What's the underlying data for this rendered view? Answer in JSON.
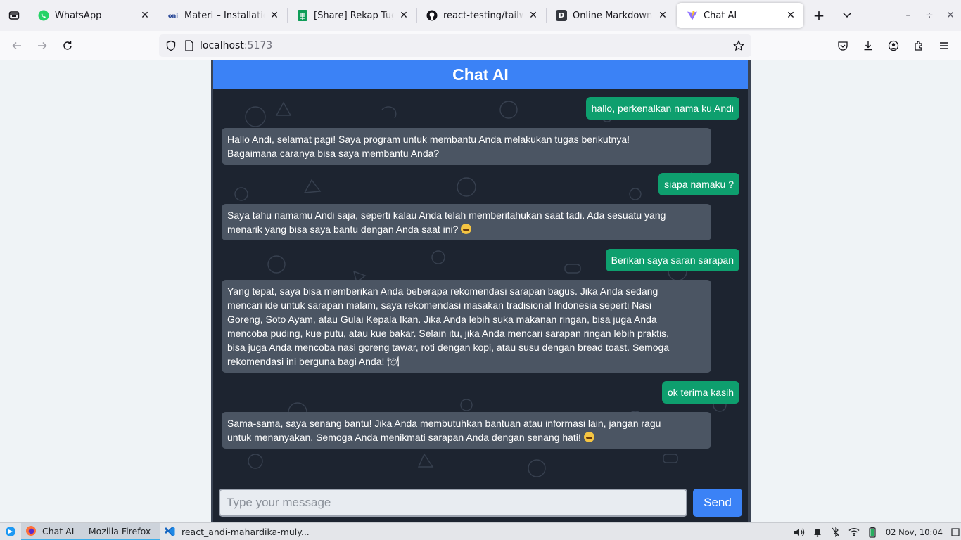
{
  "browser": {
    "tabs": [
      {
        "title": "WhatsApp",
        "favicon": "whatsapp-icon",
        "active": false
      },
      {
        "title": "Materi – Installation Op",
        "favicon": "oni-icon",
        "active": false
      },
      {
        "title": "[Share] Rekap Tugas Re",
        "favicon": "sheets-icon",
        "active": false
      },
      {
        "title": "react-testing/tailwind.c",
        "favicon": "github-icon",
        "active": false
      },
      {
        "title": "Online Markdown Edito",
        "favicon": "dillinger-icon",
        "active": false
      },
      {
        "title": "Chat AI",
        "favicon": "vite-icon",
        "active": true
      }
    ],
    "url_host": "localhost",
    "url_port": ":5173"
  },
  "app": {
    "header_title": "Chat AI",
    "messages": [
      {
        "role": "user",
        "text": "hallo, perkenalkan nama ku Andi"
      },
      {
        "role": "bot",
        "lines": [
          "Hallo Andi, selamat pagi! Saya program untuk membantu Anda melakukan tugas berikutnya!",
          "Bagaimana caranya bisa saya membantu Anda?"
        ]
      },
      {
        "role": "user",
        "text": "siapa namaku ?"
      },
      {
        "role": "bot",
        "lines": [
          "Saya tahu namamu Andi saja, seperti kalau Anda telah memberitahukan saat tadi. Ada sesuatu yang",
          "menarik yang bisa saya bantu dengan Anda saat ini?"
        ]
      },
      {
        "role": "user",
        "text": "Berikan saya saran sarapan"
      },
      {
        "role": "bot",
        "lines": [
          "Yang tepat, saya bisa memberikan Anda beberapa rekomendasi sarapan bagus. Jika Anda sedang",
          "mencari ide untuk sarapan malam, saya rekomendasi masakan tradisional Indonesia seperti Nasi",
          "Goreng, Soto Ayam, atau Gulai Kepala Ikan. Jika Anda lebih suka makanan ringan, bisa juga Anda",
          "mencoba puding, kue putu, atau kue bakar. Selain itu, jika Anda mencari sarapan ringan lebih praktis,",
          "bisa juga Anda mencoba nasi goreng tawar, roti dengan kopi, atau susu dengan bread toast. Semoga",
          "rekomendasi ini berguna bagi Anda! 🍽"
        ]
      },
      {
        "role": "user",
        "text": "ok terima kasih"
      },
      {
        "role": "bot",
        "lines": [
          "Sama-sama, saya senang bantu! Jika Anda membutuhkan bantuan atau informasi lain, jangan ragu",
          "untuk menanyakan. Semoga Anda menikmati sarapan Anda dengan senang hati!"
        ]
      }
    ],
    "input_placeholder": "Type your message",
    "send_label": "Send"
  },
  "taskbar": {
    "firefox_task": "Chat AI — Mozilla Firefox",
    "vscode_task": "react_andi-mahardika-muly...",
    "clock": "02 Nov, 10:04"
  },
  "colors": {
    "header": "#3b82f6",
    "user_bubble": "#0e9f6e",
    "bot_bubble": "#4b5563",
    "chat_bg": "#1d2430"
  }
}
